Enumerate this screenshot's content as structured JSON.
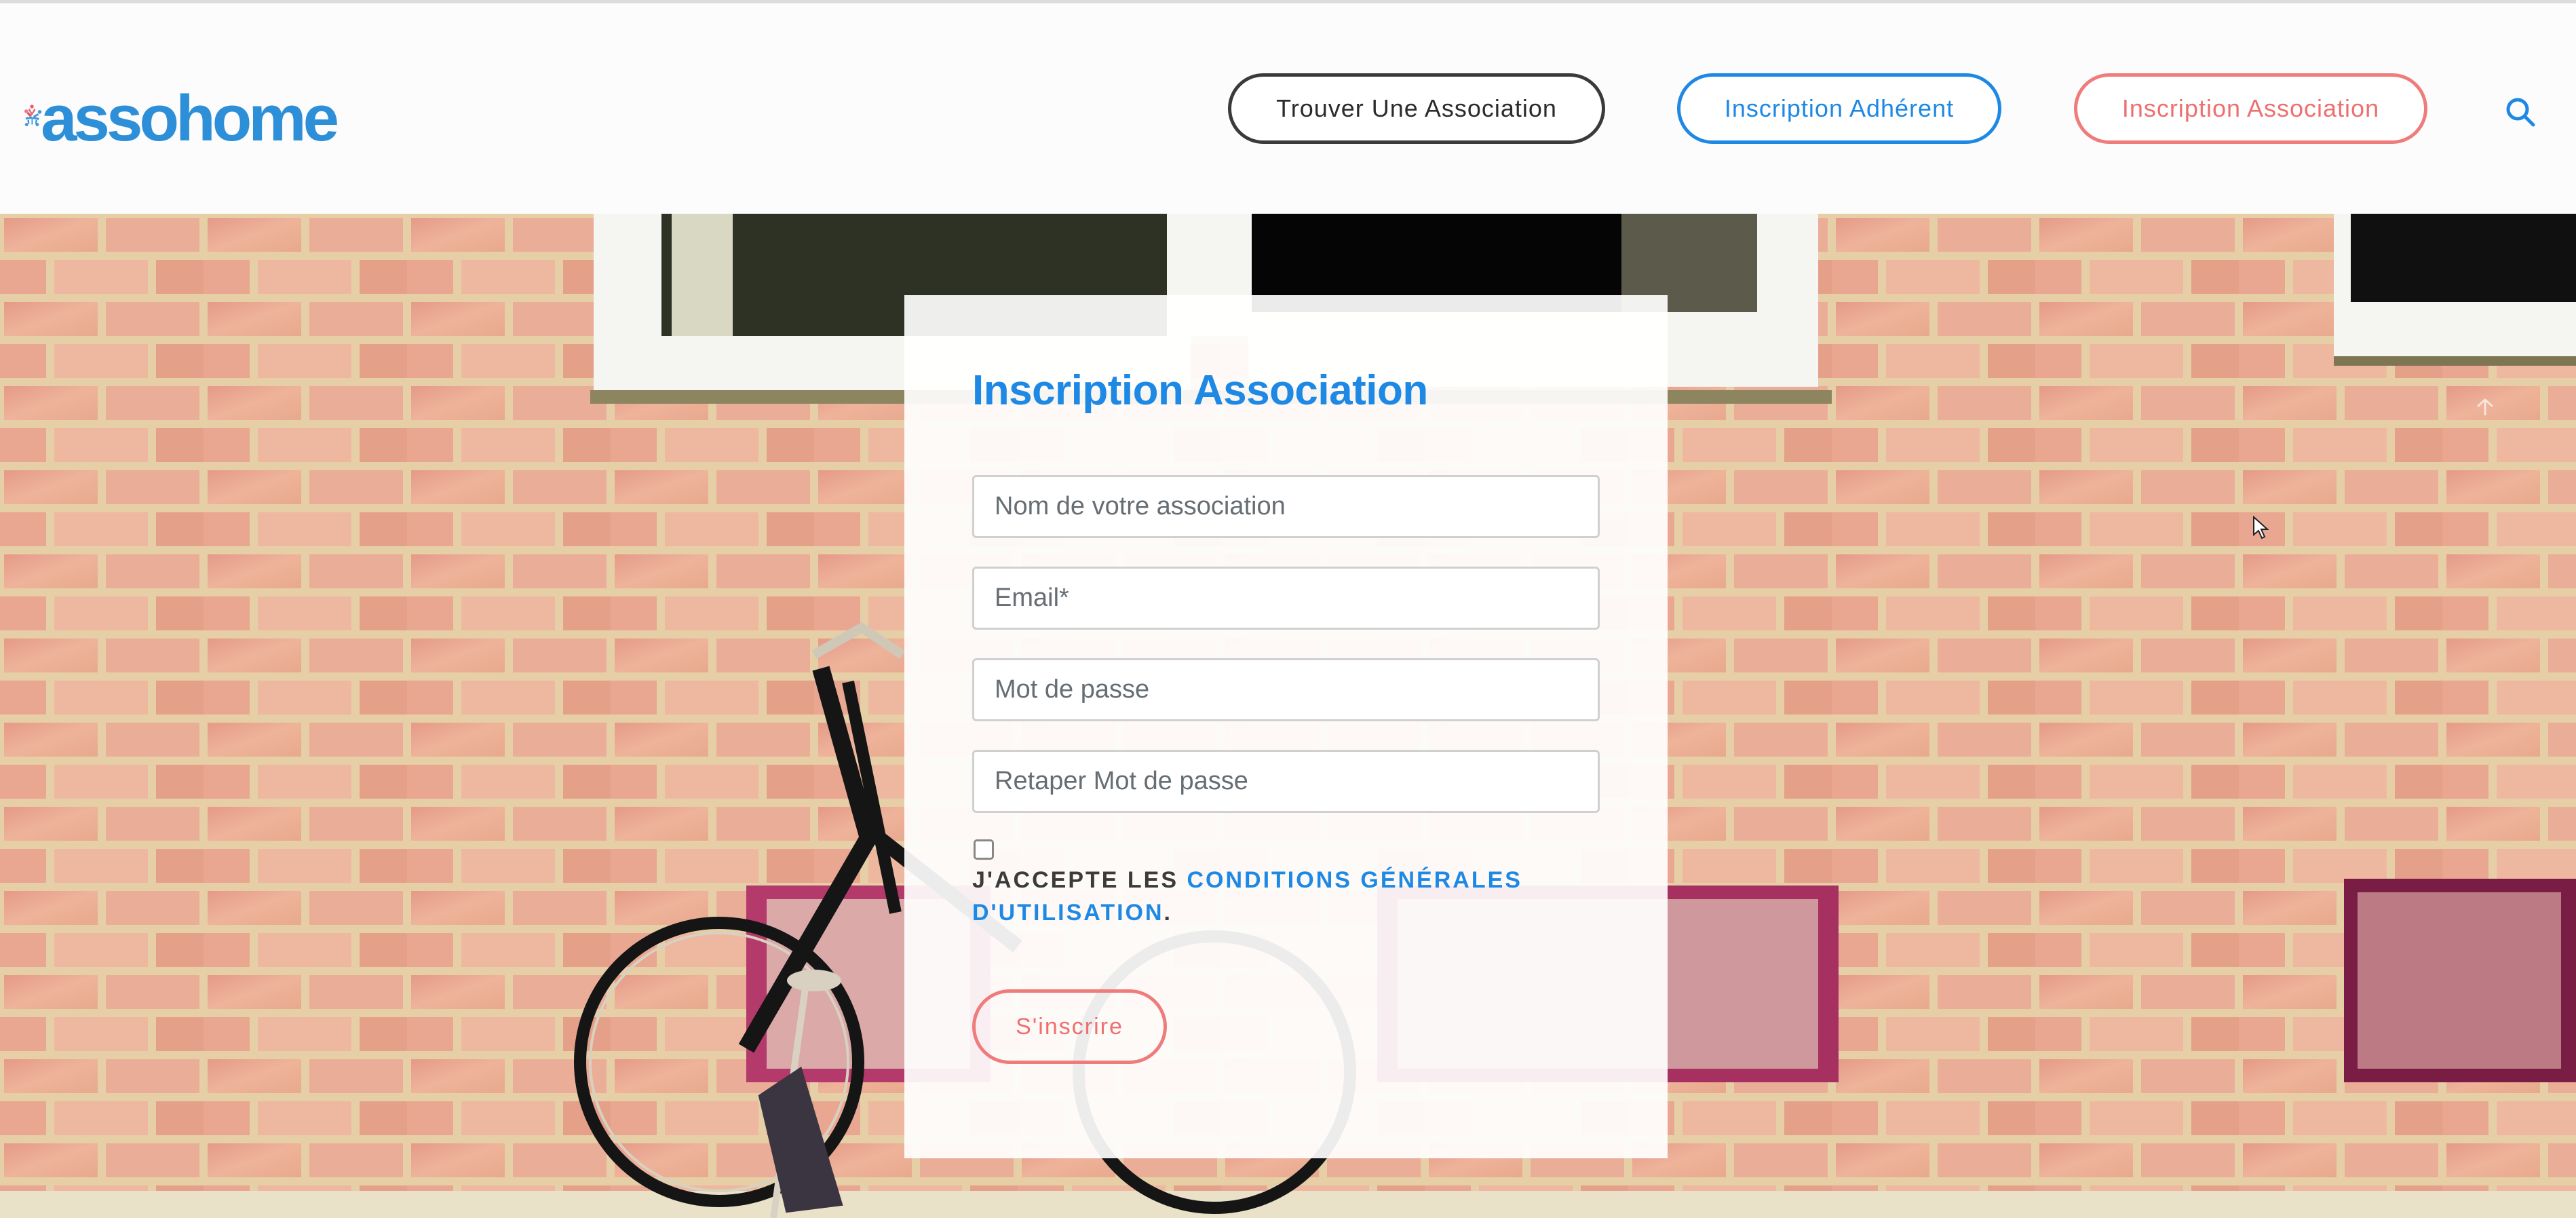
{
  "header": {
    "logo_text": "assohome",
    "nav": [
      {
        "label": "Trouver Une Association"
      },
      {
        "label": "Inscription Adhérent"
      },
      {
        "label": "Inscription Association"
      }
    ],
    "search_icon": "search-icon"
  },
  "form": {
    "title": "Inscription Association",
    "fields": [
      {
        "placeholder": "Nom de votre association",
        "value": ""
      },
      {
        "placeholder": "Email*",
        "value": ""
      },
      {
        "placeholder": "Mot de passe",
        "value": ""
      },
      {
        "placeholder": "Retaper Mot de passe",
        "value": ""
      }
    ],
    "terms_checked": false,
    "terms_prefix": "J'ACCEPTE LES ",
    "terms_link": "CONDITIONS GÉNÉRALES D'UTILISATION",
    "terms_suffix": ".",
    "submit_label": "S'inscrire"
  },
  "icons": {
    "back_to_top": "arrow-up-icon",
    "cursor": "mouse-cursor-icon"
  },
  "colors": {
    "brand_blue": "#1e88e5",
    "brand_red": "#ef7b7b",
    "dark": "#3a3a3a"
  }
}
